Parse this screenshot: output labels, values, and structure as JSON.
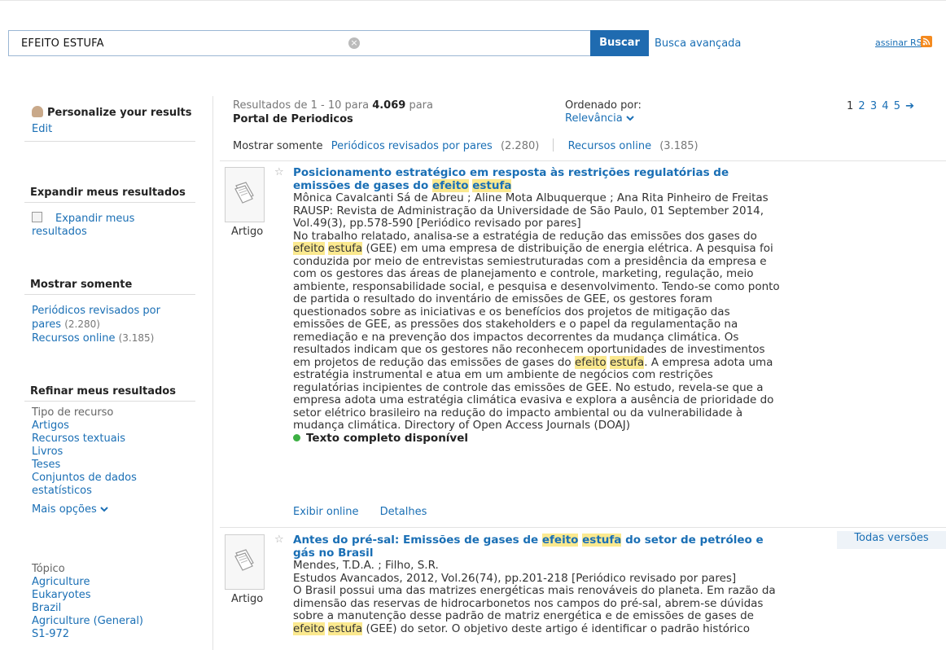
{
  "search": {
    "query": "EFEITO ESTUFA",
    "clear_glyph": "×",
    "button_label": "Buscar",
    "advanced_link": "Busca avançada",
    "rss_label": "assinar RSS"
  },
  "sidebar": {
    "personalize": {
      "label": "Personalize your results",
      "edit": "Edit"
    },
    "expand": {
      "heading": "Expandir meus resultados",
      "line1": "Expandir meus",
      "line2": "resultados"
    },
    "show_only": {
      "heading": "Mostrar somente",
      "items": [
        {
          "line1": "Periódicos revisados por",
          "line2": "pares",
          "count": "(2.280)"
        },
        {
          "label": "Recursos online",
          "count": "(3.185)"
        }
      ]
    },
    "refine": {
      "heading": "Refinar meus resultados",
      "resource_type_label": "Tipo de recurso",
      "resource_types": [
        "Artigos",
        "Recursos textuais",
        "Livros",
        "Teses"
      ],
      "datasets_line1": "Conjuntos de dados",
      "datasets_line2": "estatísticos",
      "more": "Mais opções",
      "topic_label": "Tópico",
      "topics": [
        "Agriculture",
        "Eukaryotes",
        "Brazil",
        "Agriculture (General)",
        "S1-972"
      ]
    }
  },
  "results_header": {
    "prefix": "Resultados de 1 - 10 para",
    "total": "4.069",
    "para": "para",
    "collection": "Portal de Periodicos",
    "sorted_label": "Ordenado por:",
    "sorted_value": "Relevância",
    "pages": [
      "1",
      "2",
      "3",
      "4",
      "5"
    ],
    "next_glyph": "➔",
    "show_only_label": "Mostrar somente",
    "filter1_label": "Periódicos revisados por pares",
    "filter1_count": "(2.280)",
    "filter2_label": "Recursos online",
    "filter2_count": "(3.185)"
  },
  "results": [
    {
      "type": "Artigo",
      "title_a": "Posicionamento estratégico em resposta às restrições regulatórias de emissões de gases do",
      "title_hl1": "efeito",
      "title_hl2": "estufa",
      "authors": "Mônica Cavalcanti Sá de Abreu ; Aline Mota Albuquerque ; Ana Rita Pinheiro de Freitas",
      "source": "RAUSP: Revista de Administração da Universidade de São Paulo, 01 September 2014, Vol.49(3), pp.578-590 [Periódico revisado por pares]",
      "abs1": "No trabalho relatado, analisa-se a estratégia de redução das emissões dos gases do",
      "hl_a1": "efeito",
      "hl_a2": "estufa",
      "abs2": "(GEE) em uma empresa de distribuição de energia elétrica. A pesquisa foi conduzida por meio de entrevistas semiestruturadas com a presidência da empresa e com os gestores das áreas de planejamento e controle, marketing, regulação, meio ambiente, responsabilidade social, e pesquisa e desenvolvimento. Tendo-se como ponto de partida o resultado do inventário de emissões de GEE, os gestores foram questionados sobre as iniciativas e os benefícios dos projetos de mitigação das emissões de GEE, as pressões dos stakeholders e o papel da regulamentação na remediação e na prevenção dos impactos decorrentes da mudança climática. Os resultados indicam que os gestores não reconhecem oportunidades de investimentos em projetos de redução das emissões de gases do",
      "hl_b1": "efeito",
      "hl_b2": "estufa",
      "abs3": ". A empresa adota uma estratégia instrumental e atua em um ambiente de negócios com restrições regulatórias incipientes de controle das emissões de GEE. No estudo, revela-se que a empresa adota uma estratégia climática evasiva e explora a ausência de prioridade do setor elétrico brasileiro na redução do impacto ambiental ou da vulnerabilidade à mudança climática. Directory of Open Access Journals (DOAJ)",
      "availability": "Texto completo disponível",
      "link_online": "Exibir online",
      "link_details": "Detalhes"
    },
    {
      "type": "Artigo",
      "versions": "Todas versões",
      "title_a": "Antes do pré-sal: Emissões de gases de",
      "title_hl1": "efeito",
      "title_hl2": "estufa",
      "title_b": "do setor de petróleo e gás no Brasil",
      "authors": "Mendes, T.D.A. ; Filho, S.R.",
      "source": "Estudos Avancados, 2012, Vol.26(74), pp.201-218 [Periódico revisado por pares]",
      "abs1": "O Brasil possui uma das matrizes energéticas mais renováveis do planeta. Em razão da dimensão das reservas de hidrocarbonetos nos campos do pré-sal, abrem-se dúvidas sobre a manutenção desse padrão de matriz energética e de emissões de gases de",
      "hl_a1": "efeito",
      "hl_a2": "estufa",
      "abs2": "(GEE) do setor. O objetivo deste artigo é identificar o padrão histórico"
    }
  ]
}
